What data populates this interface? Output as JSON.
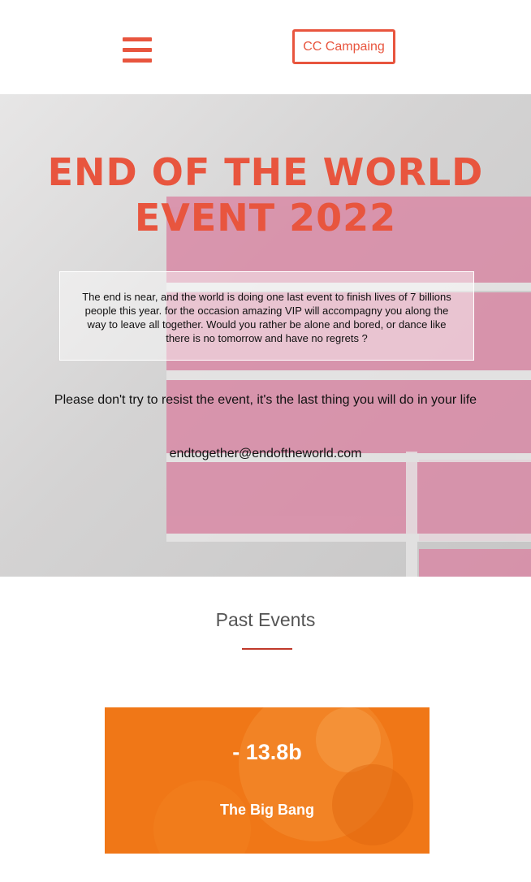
{
  "header": {
    "menu_icon": "hamburger-menu-icon",
    "campaign_button_label": "CC Campaing"
  },
  "hero": {
    "title_line1": "END OF THE WORLD",
    "title_line2": "EVENT 2022",
    "intro_text": "The end is near, and the world is doing one last event to finish lives of 7 billions people this year. for the occasion amazing VIP will accompagny you along the way to leave all together. Would you rather be alone and bored, or dance like there is no tomorrow and have no regrets ?",
    "warning_text": "Please don't try to resist the event, it's the last thing you will do in your life",
    "email": "endtogether@endoftheworld.com"
  },
  "past_events": {
    "title": "Past Events",
    "items": [
      {
        "year": "- 13.8b",
        "name": "The Big Bang"
      }
    ]
  },
  "colors": {
    "accent": "#e8553e",
    "event_card": "#f07717",
    "hero_pink": "#d98aa6"
  }
}
